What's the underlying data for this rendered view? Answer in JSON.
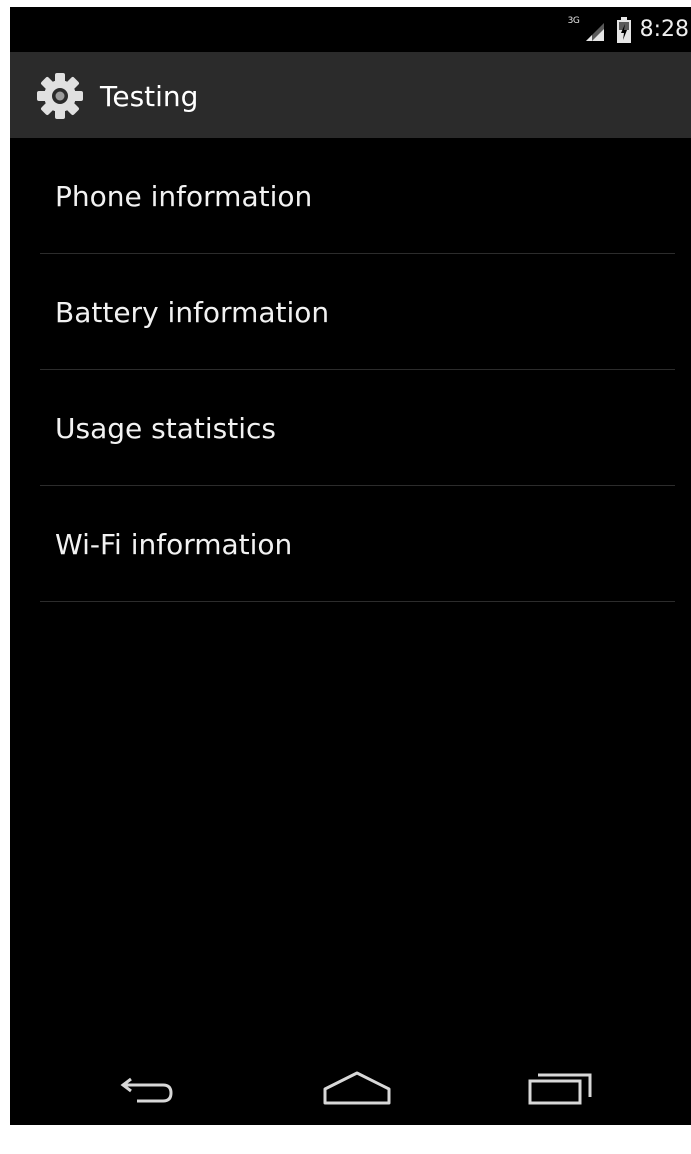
{
  "status_bar": {
    "network_type": "3G",
    "time": "8:28",
    "icons": [
      "signal-icon",
      "battery-icon"
    ]
  },
  "action_bar": {
    "icon": "gear-icon",
    "title": "Testing"
  },
  "menu": {
    "items": [
      {
        "label": "Phone information"
      },
      {
        "label": "Battery information"
      },
      {
        "label": "Usage statistics"
      },
      {
        "label": "Wi-Fi information"
      }
    ]
  },
  "nav_bar": {
    "icons": [
      "back-icon",
      "home-icon",
      "recents-icon"
    ]
  }
}
